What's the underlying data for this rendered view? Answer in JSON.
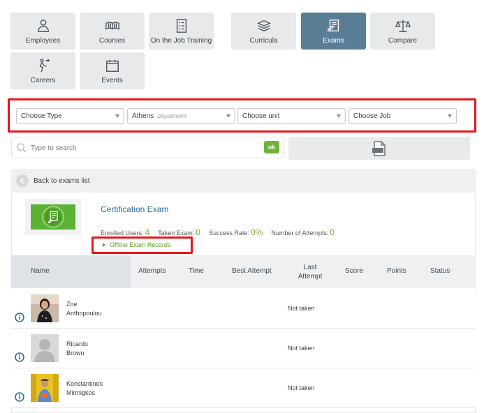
{
  "nav": {
    "tiles": [
      {
        "label": "Employees",
        "icon": "user-icon"
      },
      {
        "label": "Courses",
        "icon": "book-icon"
      },
      {
        "label": "On the Job Training",
        "icon": "checklist-icon"
      },
      {
        "label": "Curricula",
        "icon": "books-stack-icon"
      },
      {
        "label": "Exams",
        "icon": "exam-icon",
        "active": true
      },
      {
        "label": "Compare",
        "icon": "scales-icon"
      },
      {
        "label": "Careers",
        "icon": "career-icon"
      },
      {
        "label": "Events",
        "icon": "calendar-icon"
      }
    ]
  },
  "filters": {
    "type": "Choose Type",
    "department": "Athens",
    "department_hint": "Department",
    "unit": "Choose unit",
    "job": "Choose Job"
  },
  "search": {
    "placeholder": "Type to search",
    "ok_label": "ok"
  },
  "back_label": "Back to exams list",
  "exam": {
    "title": "Certification Exam",
    "enrolled_label": "Enrolled Users:",
    "enrolled_value": "4",
    "taken_label": "Taken Exam:",
    "taken_value": "0",
    "success_label": "Success Rate:",
    "success_value": "0%",
    "attempts_label": "Number of Attempts:",
    "attempts_value": "0",
    "offline_link": "Offline Exam Records"
  },
  "table": {
    "columns": {
      "name": "Name",
      "attempts": "Attempts",
      "time": "Time",
      "best_attempt": "Best Attempt",
      "last_attempt_1": "Last",
      "last_attempt_2": "Attempt",
      "score": "Score",
      "points": "Points",
      "status": "Status"
    },
    "rows": [
      {
        "first": "Zoe",
        "last": "Anthopoulou",
        "status": "Not taken"
      },
      {
        "first": "Ricardo",
        "last": "Brown",
        "status": "Not taken"
      },
      {
        "first": "Konstantinos",
        "last": "Mirmigkos",
        "status": "Not taken"
      }
    ]
  },
  "colors": {
    "active_tile": "#5a7d96",
    "accent_green": "#6fb534",
    "highlight_red": "#e8141a",
    "link_blue": "#2d6fa5"
  }
}
